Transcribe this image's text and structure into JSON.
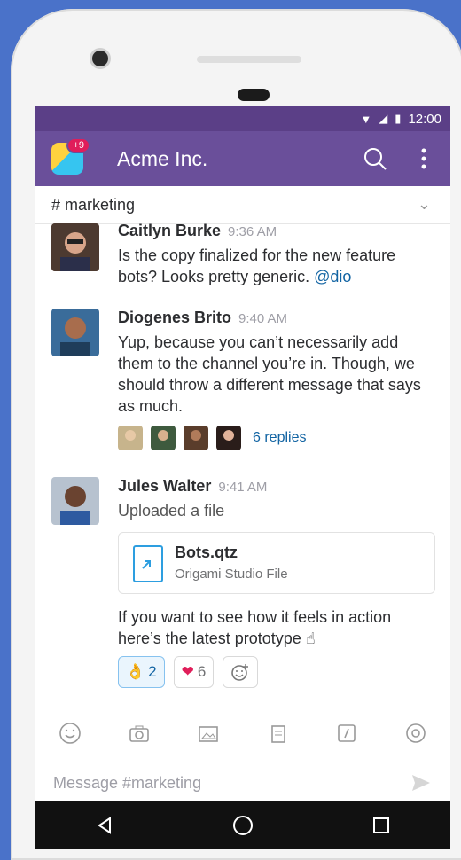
{
  "status": {
    "time": "12:00"
  },
  "app": {
    "title": "Acme Inc.",
    "notification_badge": "+9"
  },
  "channel": {
    "name": "# marketing"
  },
  "messages": [
    {
      "author": "Caitlyn Burke",
      "time": "9:36 AM",
      "text": "Is the copy finalized for the new feature bots? Looks pretty generic. ",
      "mention": "@dio"
    },
    {
      "author": "Diogenes Brito",
      "time": "9:40 AM",
      "text": "Yup, because you can’t necessarily add them to the channel you’re in. Though, we should throw a different message that says as much.",
      "replies": "6 replies"
    },
    {
      "author": "Jules Walter",
      "time": "9:41 AM",
      "text": "Uploaded a file",
      "file": {
        "title": "Bots.qtz",
        "subtitle": "Origami Studio File"
      },
      "followup": "If you want to see how it feels in action here’s the latest prototype ☝",
      "reactions": [
        {
          "emoji": "👌",
          "count": "2"
        },
        {
          "emoji": "❤",
          "count": "6"
        }
      ]
    }
  ],
  "composer": {
    "placeholder": "Message #marketing"
  },
  "colors": {
    "accent": "#6a4f9a",
    "link": "#1264a3"
  }
}
